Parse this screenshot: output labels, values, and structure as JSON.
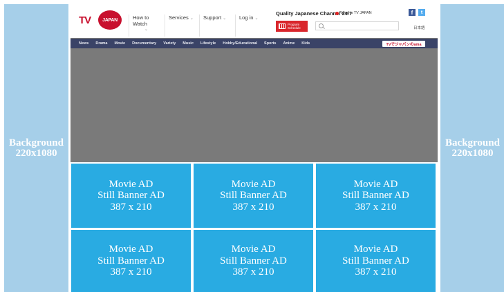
{
  "background_panels": [
    {
      "label": "Background",
      "size": "220x1080"
    },
    {
      "label": "Background",
      "size": "220x1080"
    }
  ],
  "site": {
    "logo": {
      "left_text": "TV",
      "circle_text": "JAPAN"
    },
    "nav": [
      {
        "label": "How to Watch"
      },
      {
        "label": "Services"
      },
      {
        "label": "Support"
      },
      {
        "label": "Log in"
      }
    ],
    "tagline": "Quality Japanese Channel 24/7",
    "about_link": "What is TV JAPAN",
    "social": {
      "facebook": "f",
      "twitter": "t"
    },
    "program_button": {
      "line1": "Program",
      "line2": "Schedule"
    },
    "search": {
      "icon": "search-icon",
      "value": ""
    },
    "language_link": "日本語",
    "categories": [
      "News",
      "Drama",
      "Movie",
      "Documentary",
      "Variety",
      "Music",
      "Lifestyle",
      "Hobby/Educational",
      "Sports",
      "Anime",
      "Kids"
    ],
    "promo_banner": "TVでジャパンのama"
  },
  "ads": [
    {
      "line1": "Movie AD",
      "line2": "Still Banner AD",
      "line3": "387 x 210"
    },
    {
      "line1": "Movie AD",
      "line2": "Still Banner AD",
      "line3": "387 x 210"
    },
    {
      "line1": "Movie AD",
      "line2": "Still Banner AD",
      "line3": "387 x 210"
    },
    {
      "line1": "Movie AD",
      "line2": "Still Banner AD",
      "line3": "387 x 210"
    },
    {
      "line1": "Movie AD",
      "line2": "Still Banner AD",
      "line3": "387 x 210"
    },
    {
      "line1": "Movie AD",
      "line2": "Still Banner AD",
      "line3": "387 x 210"
    }
  ],
  "colors": {
    "background_panel": "#a6cfe9",
    "ad_block": "#29abe2",
    "site_body": "#7a7a7a",
    "category_nav": "#3a4367",
    "brand_red": "#c8102e"
  }
}
